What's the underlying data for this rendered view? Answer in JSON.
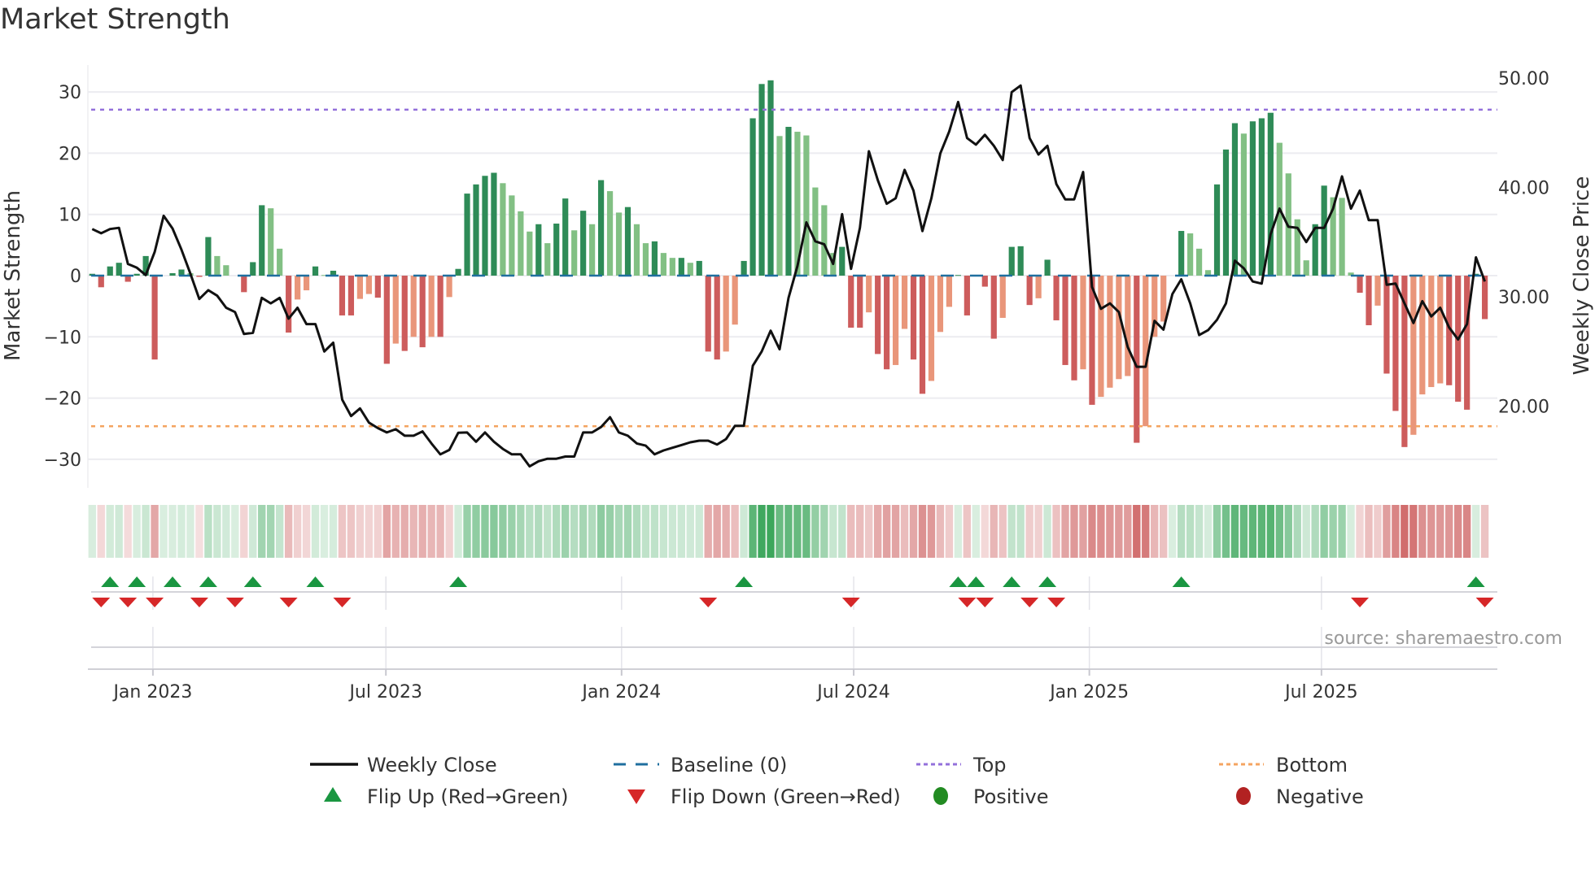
{
  "title": "Market Strength",
  "source": "source: sharemaestro.com",
  "colors": {
    "pos_strong": "#2e8b57",
    "pos_weak": "#82c084",
    "neg_strong": "#cd5c5c",
    "neg_weak": "#e9967a",
    "line": "#111111",
    "baseline": "#1f6f9f",
    "top": "#9370db",
    "bottom": "#f4a460",
    "flip_up": "#1a9641",
    "flip_down": "#d62728",
    "positive": "#228b22",
    "negative": "#b22222",
    "grid": "#ececf0"
  },
  "chart_data": {
    "type": "bar+line",
    "title": "Market Strength",
    "ylabel": "Market Strength",
    "y2label": "Weekly Close Price",
    "ylim": [
      -33,
      36
    ],
    "y2lim": [
      14.2,
      51.1
    ],
    "yticks": [
      "30",
      "20",
      "10",
      "0",
      "−10",
      "−20",
      "−30"
    ],
    "ytick_values": [
      30,
      20,
      10,
      0,
      -10,
      -20,
      -30
    ],
    "y2ticks": [
      "50.00",
      "40.00",
      "30.00",
      "20.00"
    ],
    "y2tick_values": [
      50,
      40,
      30,
      20
    ],
    "x_ticks": [
      {
        "label": "Jan 2023",
        "week": 6.8
      },
      {
        "label": "Jul 2023",
        "week": 32.9
      },
      {
        "label": "Jan 2024",
        "week": 59.3
      },
      {
        "label": "Jul 2024",
        "week": 85.3
      },
      {
        "label": "Jan 2025",
        "week": 111.7
      },
      {
        "label": "Jul 2025",
        "week": 137.7
      }
    ],
    "grid": true,
    "top_level": 27.1,
    "bottom_level": -24.6,
    "baseline": 0,
    "strength": [
      0.3,
      -1.9,
      1.5,
      2.1,
      -1.0,
      0.3,
      3.2,
      -13.7,
      0,
      0.4,
      1.0,
      0.4,
      -0.2,
      6.3,
      3.2,
      1.7,
      0,
      -2.7,
      2.2,
      11.5,
      11.0,
      4.4,
      -9.3,
      -3.9,
      -2.4,
      1.5,
      0.1,
      0.8,
      -6.5,
      -6.5,
      -3.8,
      -3.0,
      -3.6,
      -14.4,
      -11.1,
      -12.3,
      -10,
      -11.7,
      -10,
      -10,
      -3.5,
      1.1,
      13.4,
      14.9,
      16.3,
      16.8,
      15.1,
      13.1,
      10.5,
      7.2,
      8.4,
      5.3,
      8.5,
      12.6,
      7.4,
      10.6,
      8.4,
      15.6,
      13.8,
      10.3,
      11.2,
      8.4,
      5.3,
      5.6,
      3.7,
      2.9,
      2.9,
      2.1,
      2.4,
      -12.4,
      -13.7,
      -12.4,
      -8.0,
      2.4,
      25.7,
      31.3,
      31.9,
      22.8,
      24.3,
      23.5,
      22.9,
      14.4,
      11.5,
      3.7,
      4.7,
      -8.5,
      -8.5,
      -6.0,
      -12.8,
      -15.3,
      -14.6,
      -8.7,
      -13.7,
      -19.3,
      -17.2,
      -9.2,
      -5.1,
      0.1,
      -6.5,
      0.1,
      -1.8,
      -10.3,
      -6.9,
      4.7,
      4.8,
      -4.8,
      -3.7,
      2.6,
      -7.3,
      -14.6,
      -17.1,
      -15.3,
      -21.1,
      -19.8,
      -18.3,
      -16.9,
      -16.4,
      -27.3,
      -24.6,
      -10,
      -7.5,
      0,
      7.3,
      6.9,
      4.4,
      0.9,
      14.9,
      20.6,
      24.9,
      23.2,
      25.2,
      25.7,
      26.6,
      21.7,
      16.7,
      9.2,
      2.5,
      8.4,
      14.7,
      12.8,
      12.7,
      0.5,
      -2.8,
      -8.1,
      -4.9,
      -16.0,
      -22.1,
      -28.0,
      -26.0,
      -19.4,
      -18.2,
      -17.6,
      -17.9,
      -20.6,
      -21.9,
      0.3,
      -7.1
    ],
    "weekly_close": [
      36.19,
      35.8,
      36.19,
      36.3,
      33.0,
      32.65,
      31.98,
      34.1,
      37.4,
      36.24,
      34.3,
      32.1,
      29.8,
      30.6,
      30.1,
      29.0,
      28.6,
      26.6,
      26.7,
      29.9,
      29.4,
      29.9,
      28.0,
      29.0,
      27.5,
      27.5,
      25.0,
      25.8,
      20.6,
      19.1,
      19.8,
      18.5,
      18.0,
      17.6,
      17.9,
      17.3,
      17.3,
      17.7,
      16.6,
      15.6,
      16.0,
      17.57,
      17.6,
      16.75,
      17.6,
      16.75,
      16.1,
      15.6,
      15.6,
      14.5,
      14.97,
      15.2,
      15.2,
      15.4,
      15.4,
      17.6,
      17.6,
      18.1,
      19.0,
      17.6,
      17.3,
      16.6,
      16.4,
      15.6,
      15.96,
      16.2,
      16.45,
      16.7,
      16.85,
      16.85,
      16.5,
      17.0,
      18.2,
      18.2,
      23.7,
      25.0,
      26.9,
      25.2,
      29.9,
      32.8,
      36.8,
      35.07,
      34.8,
      33.0,
      37.55,
      32.55,
      36.3,
      43.3,
      40.65,
      38.5,
      39.0,
      41.6,
      39.7,
      36.0,
      39.0,
      43.1,
      45.1,
      47.8,
      44.5,
      43.9,
      44.8,
      43.8,
      42.5,
      48.7,
      49.3,
      44.5,
      43.0,
      43.8,
      40.3,
      38.9,
      38.9,
      41.4,
      30.9,
      28.9,
      29.4,
      28.6,
      25.4,
      23.6,
      23.6,
      27.8,
      27.0,
      30.25,
      31.6,
      29.4,
      26.5,
      26.95,
      27.9,
      29.4,
      33.3,
      32.6,
      31.4,
      31.2,
      35.7,
      38.05,
      36.4,
      36.3,
      35.0,
      36.3,
      36.3,
      38.05,
      41.0,
      38.05,
      39.7,
      37.0,
      37.0,
      31.1,
      31.2,
      29.4,
      27.6,
      29.6,
      28.2,
      29.0,
      27.2,
      26.1,
      27.5,
      33.6,
      31.4
    ],
    "flip_up_weeks": [
      2,
      5,
      9,
      13,
      18,
      25,
      41,
      73,
      97,
      99,
      103,
      107,
      122,
      155
    ],
    "flip_down_weeks": [
      1,
      4,
      7,
      12,
      16,
      22,
      28,
      69,
      85,
      98,
      100,
      105,
      108,
      142,
      156
    ],
    "legend": {
      "placement": "bottom",
      "items": [
        {
          "key": "line",
          "label": "Weekly Close"
        },
        {
          "key": "baseline",
          "label": "Baseline (0)"
        },
        {
          "key": "top",
          "label": "Top"
        },
        {
          "key": "bottom",
          "label": "Bottom"
        },
        {
          "key": "flip_up",
          "label": "Flip Up (Red→Green)"
        },
        {
          "key": "flip_down",
          "label": "Flip Down (Green→Red)"
        },
        {
          "key": "positive",
          "label": "Positive"
        },
        {
          "key": "negative",
          "label": "Negative"
        }
      ]
    }
  }
}
